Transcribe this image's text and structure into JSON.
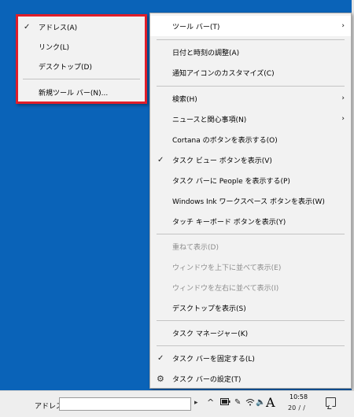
{
  "submenu": {
    "items": [
      {
        "label": "アドレス(A)",
        "checked": true
      },
      {
        "label": "リンク(L)",
        "checked": false
      },
      {
        "label": "デスクトップ(D)",
        "checked": false
      },
      {
        "label": "新規ツール バー(N)...",
        "checked": false
      }
    ]
  },
  "context_menu": {
    "items": [
      {
        "label": "ツール バー(T)",
        "has_submenu": true
      },
      {
        "label": "日付と時刻の調整(A)"
      },
      {
        "label": "通知アイコンのカスタマイズ(C)"
      },
      {
        "label": "検索(H)",
        "has_submenu": true
      },
      {
        "label": "ニュースと関心事項(N)",
        "has_submenu": true
      },
      {
        "label": "Cortana のボタンを表示する(O)"
      },
      {
        "label": "タスク ビュー ボタンを表示(V)",
        "checked": true
      },
      {
        "label": "タスク バーに People を表示する(P)"
      },
      {
        "label": "Windows Ink ワークスペース ボタンを表示(W)"
      },
      {
        "label": "タッチ キーボード ボタンを表示(Y)"
      },
      {
        "label": "重ねて表示(D)",
        "disabled": true
      },
      {
        "label": "ウィンドウを上下に並べて表示(E)",
        "disabled": true
      },
      {
        "label": "ウィンドウを左右に並べて表示(I)",
        "disabled": true
      },
      {
        "label": "デスクトップを表示(S)"
      },
      {
        "label": "タスク マネージャー(K)"
      },
      {
        "label": "タスク バーを固定する(L)",
        "checked": true
      },
      {
        "label": "タスク バーの設定(T)",
        "icon": "gear-icon"
      }
    ]
  },
  "taskbar": {
    "address_label": "アドレス",
    "address_value": "",
    "chevron_up": "^",
    "ime_mode": "A",
    "clock_time": "10:58",
    "clock_date": "20  /  /"
  },
  "colors": {
    "desktop": "#0a63b8",
    "menu_bg": "#f2f2f2",
    "highlight_border": "#e01e2a"
  }
}
